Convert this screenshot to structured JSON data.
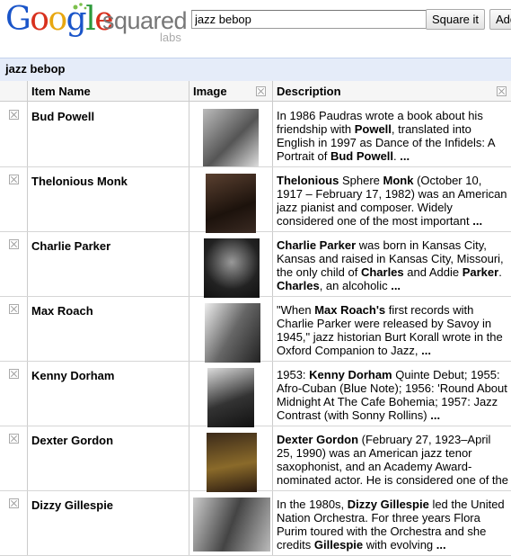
{
  "header": {
    "logo_text": "Google",
    "product": "squared",
    "labs": "labs",
    "search_value": "jazz bebop",
    "square_button": "Square it",
    "add_button": "Add"
  },
  "query": {
    "label": "jazz bebop"
  },
  "columns": {
    "item_name": "Item Name",
    "image": "Image",
    "description": "Description"
  },
  "rows": [
    {
      "name": "Bud Powell",
      "description_parts": [
        {
          "t": "In 1986 Paudras wrote a book about his friendship with "
        },
        {
          "t": "Powell",
          "b": true
        },
        {
          "t": ", translated into English in 1997 as Dance of the Infidels: A Portrait of "
        },
        {
          "t": "Bud Powell",
          "b": true
        },
        {
          "t": ". "
        },
        {
          "t": "...",
          "b": true
        }
      ]
    },
    {
      "name": "Thelonious Monk",
      "description_parts": [
        {
          "t": "Thelonious",
          "b": true
        },
        {
          "t": " Sphere "
        },
        {
          "t": "Monk",
          "b": true
        },
        {
          "t": " (October 10, 1917 – February 17, 1982) was an American jazz pianist and composer. Widely considered one of the most important "
        },
        {
          "t": "...",
          "b": true
        }
      ]
    },
    {
      "name": "Charlie Parker",
      "description_parts": [
        {
          "t": "Charlie Parker",
          "b": true
        },
        {
          "t": " was born in Kansas City, Kansas and raised in Kansas City, Missouri, the only child of "
        },
        {
          "t": "Charles",
          "b": true
        },
        {
          "t": " and Addie "
        },
        {
          "t": "Parker",
          "b": true
        },
        {
          "t": ". "
        },
        {
          "t": "Charles",
          "b": true
        },
        {
          "t": ", an alcoholic "
        },
        {
          "t": "...",
          "b": true
        }
      ]
    },
    {
      "name": "Max Roach",
      "description_parts": [
        {
          "t": "\"When "
        },
        {
          "t": "Max Roach's",
          "b": true
        },
        {
          "t": " first records with Charlie Parker were released by Savoy in 1945,\" jazz historian Burt Korall wrote in the Oxford Companion to Jazz, "
        },
        {
          "t": "...",
          "b": true
        }
      ]
    },
    {
      "name": "Kenny Dorham",
      "description_parts": [
        {
          "t": "1953: "
        },
        {
          "t": "Kenny Dorham",
          "b": true
        },
        {
          "t": " Quinte Debut; 1955: Afro-Cuban (Blue Note); 1956: 'Round About Midnight At The Cafe Bohemia; 1957: Jazz Contrast (with Sonny Rollins) "
        },
        {
          "t": "...",
          "b": true
        }
      ]
    },
    {
      "name": "Dexter Gordon",
      "description_parts": [
        {
          "t": "Dexter Gordon",
          "b": true
        },
        {
          "t": " (February 27, 1923–April 25, 1990) was an American jazz tenor saxophonist, and an Academy Award-nominated actor. He is considered one of the"
        }
      ]
    },
    {
      "name": "Dizzy Gillespie",
      "description_parts": [
        {
          "t": "In the 1980s, "
        },
        {
          "t": "Dizzy Gillespie",
          "b": true
        },
        {
          "t": " led the United Nation Orchestra. For three years Flora Purim toured with the Orchestra and she credits "
        },
        {
          "t": "Gillespie",
          "b": true
        },
        {
          "t": " with evolving "
        },
        {
          "t": "...",
          "b": true
        }
      ]
    }
  ]
}
